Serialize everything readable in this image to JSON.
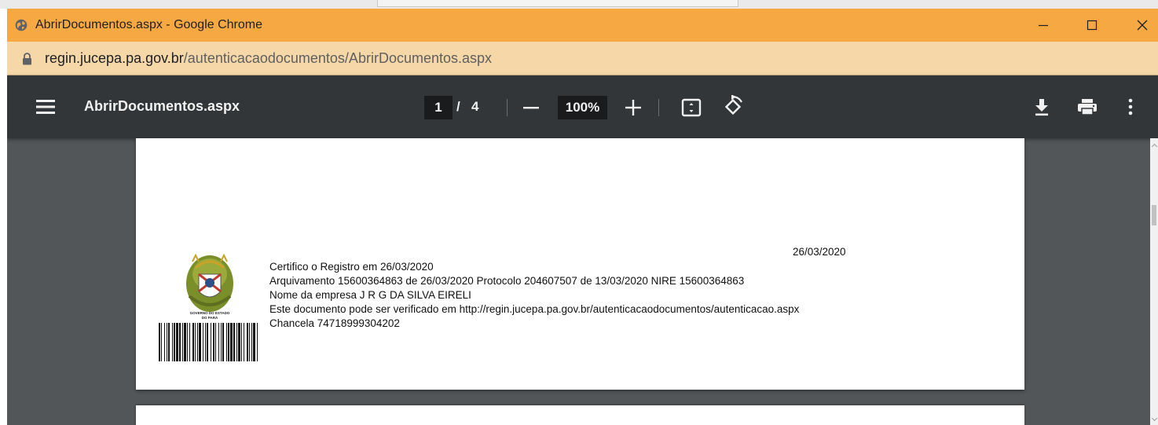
{
  "window": {
    "title": "AbrirDocumentos.aspx - Google Chrome",
    "title_color": "#f6a842"
  },
  "address_bar": {
    "url_host": "regin.jucepa.pa.gov.br",
    "url_path": "/autenticacaodocumentos/AbrirDocumentos.aspx"
  },
  "pdf_toolbar": {
    "doc_title": "AbrirDocumentos.aspx",
    "current_page": "1",
    "separator": "/",
    "total_pages": "4",
    "zoom": "100%"
  },
  "document": {
    "date": "26/03/2020",
    "lines": [
      "Certifico o Registro em 26/03/2020",
      "Arquivamento 15600364863 de 26/03/2020 Protocolo 204607507 de 13/03/2020 NIRE 15600364863",
      "Nome da empresa J R G DA SILVA EIRELI",
      "Este documento pode ser verificado em http://regin.jucepa.pa.gov.br/autenticacaodocumentos/autenticacao.aspx",
      "Chancela 74718999304202"
    ],
    "coat_of_arms_caption": [
      "GOVERNO DO ESTADO",
      "DO PARÁ"
    ]
  }
}
